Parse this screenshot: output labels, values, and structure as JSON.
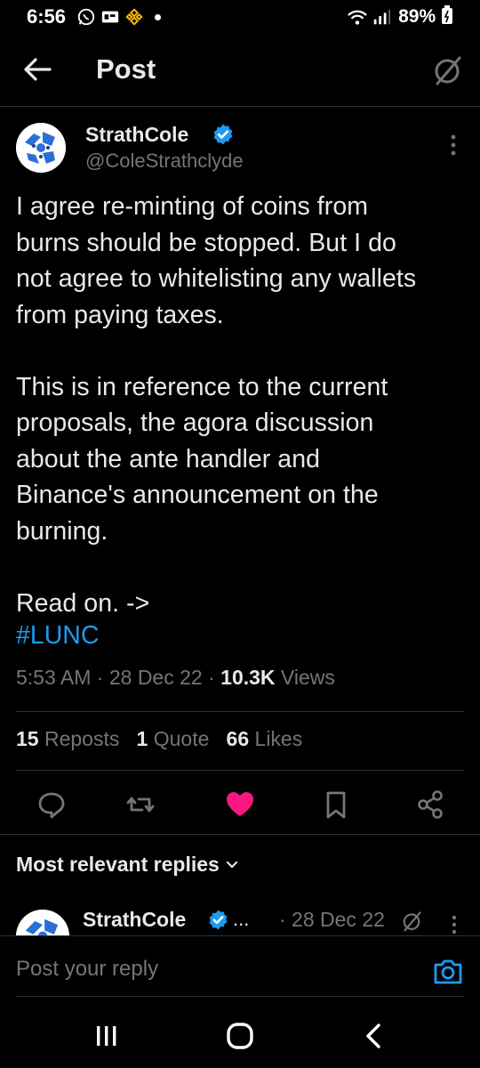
{
  "status_bar": {
    "time": "6:56",
    "battery": "89%"
  },
  "header": {
    "title": "Post"
  },
  "author": {
    "name": "StrathCole",
    "handle": "@ColeStrathclyde"
  },
  "post": {
    "text": "I agree re-minting of coins from\nburns should be stopped. But I do\nnot agree to whitelisting any wallets\nfrom paying taxes.\n\nThis is in reference to the current\nproposals, the agora discussion\nabout the ante handler and\nBinance's announcement on the\nburning.\n\nRead on. ->",
    "hashtag": "#LUNC",
    "time": "5:53 AM",
    "date": "28 Dec 22",
    "views_count": "10.3K",
    "views_label": "Views"
  },
  "stats": {
    "reposts_count": "15",
    "reposts_label": "Reposts",
    "quotes_count": "1",
    "quotes_label": "Quote",
    "likes_count": "66",
    "likes_label": "Likes"
  },
  "replies": {
    "heading": "Most relevant replies",
    "first": {
      "name": "StrathCole",
      "ellipsis": "...",
      "date": "· 28 Dec 22"
    }
  },
  "composer": {
    "placeholder": "Post your reply"
  },
  "colors": {
    "accent": "#1d9bf0",
    "like": "#f91880",
    "muted": "#71767b"
  },
  "icons": [
    "back-arrow-icon",
    "grok-icon",
    "verified-icon",
    "more-icon",
    "reply-icon",
    "repost-icon",
    "like-icon",
    "bookmark-icon",
    "share-icon",
    "chevron-down-icon",
    "camera-icon",
    "recents-icon",
    "home-icon",
    "back-icon"
  ]
}
